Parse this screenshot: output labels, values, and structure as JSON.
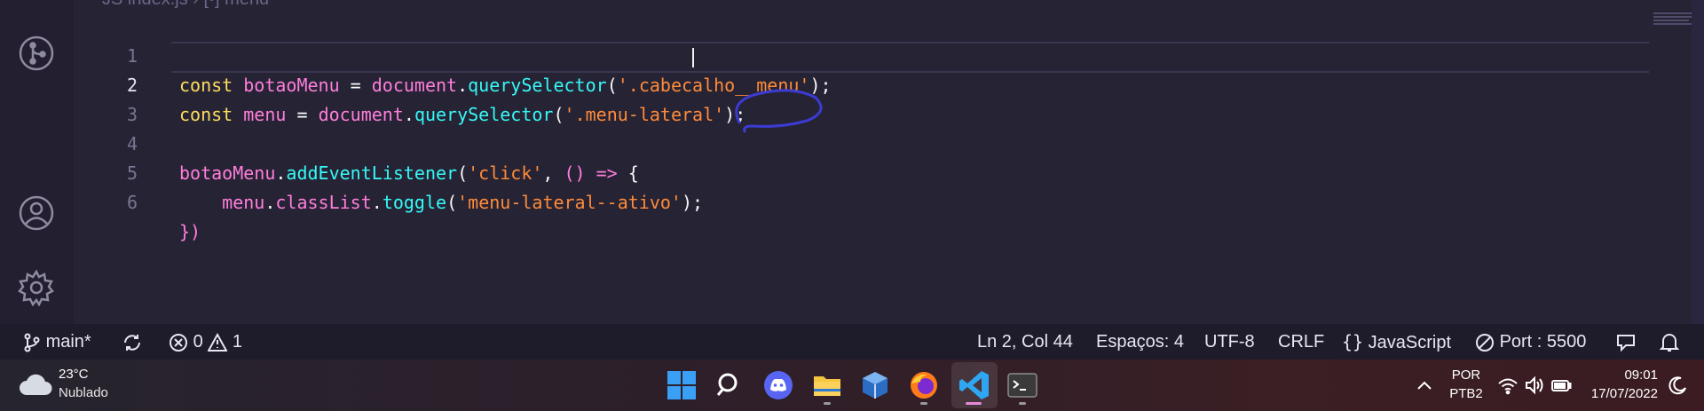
{
  "editor": {
    "breadcrumb": "JS index.js › [•] menu",
    "lines": [
      {
        "num": "1"
      },
      {
        "num": "2"
      },
      {
        "num": "3"
      },
      {
        "num": "4"
      },
      {
        "num": "5"
      },
      {
        "num": "6"
      }
    ],
    "code": {
      "l1_kw": "const",
      "l1_var": "botaoMenu",
      "l1_eq": " = ",
      "l1_obj": "document",
      "l1_fn": "querySelector",
      "l1_str": "'.cabecalho__menu'",
      "l2_kw": "const",
      "l2_var": "menu",
      "l2_eq": " = ",
      "l2_obj": "document",
      "l2_fn": "querySelector",
      "l2_str": "'.menu-lateral'",
      "l4_obj": "botaoMenu",
      "l4_fn": "addEventListener",
      "l4_str": "'click'",
      "l4_arrow": "() =>",
      "l5_obj": "menu",
      "l5_prop": "classList",
      "l5_fn": "toggle",
      "l5_str": "'menu-lateral--ativo'",
      "l6": "})"
    }
  },
  "statusbar": {
    "branch": "main*",
    "errors": "0",
    "warnings": "1",
    "position": "Ln 2, Col 44",
    "spaces": "Espaços: 4",
    "encoding": "UTF-8",
    "eol": "CRLF",
    "language": "JavaScript",
    "port": "Port : 5500"
  },
  "taskbar": {
    "temperature": "23°C",
    "condition": "Nublado",
    "lang1": "POR",
    "lang2": "PTB2",
    "time": "09:01",
    "date": "17/07/2022"
  },
  "colors": {
    "editor_bg": "#262335",
    "keyword": "#fede5d",
    "variable": "#ff7edb",
    "function": "#36f9f6",
    "string": "#ff8b39",
    "annotation": "#3b3bd4"
  }
}
